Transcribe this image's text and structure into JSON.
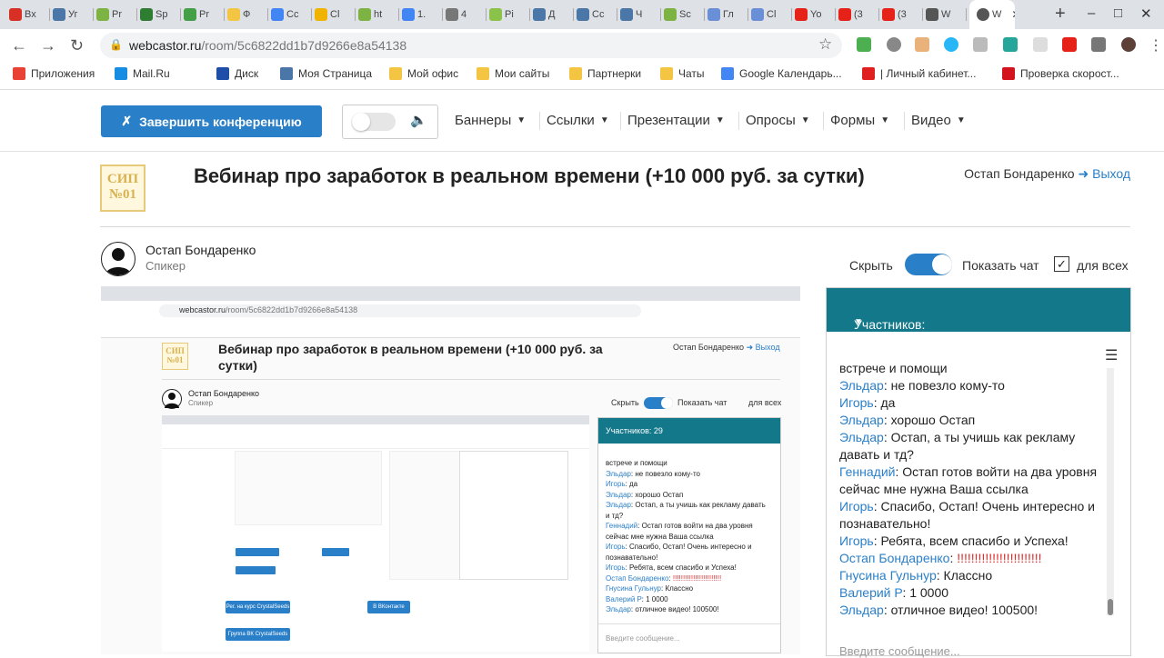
{
  "browser": {
    "tabs": [
      {
        "label": "Вх",
        "icon": "gmail-icon",
        "color": "#d93025"
      },
      {
        "label": "Уг",
        "icon": "vk-icon",
        "color": "#4a76a8"
      },
      {
        "label": "Pr",
        "icon": "jc-icon",
        "color": "#7cb342"
      },
      {
        "label": "Sp",
        "icon": "s-icon",
        "color": "#2e7d32"
      },
      {
        "label": "Pr",
        "icon": "b-icon",
        "color": "#43a047"
      },
      {
        "label": "Ф",
        "icon": "folder-icon",
        "color": "#f4c542"
      },
      {
        "label": "Сс",
        "icon": "doc-icon",
        "color": "#4285f4"
      },
      {
        "label": "Cl",
        "icon": "eye-icon",
        "color": "#f0b400"
      },
      {
        "label": "ht",
        "icon": "jc-icon",
        "color": "#7cb342"
      },
      {
        "label": "1.",
        "icon": "google-icon",
        "color": "#4285f4"
      },
      {
        "label": "4",
        "icon": "page-icon",
        "color": "#777777"
      },
      {
        "label": "Pi",
        "icon": "pb-icon",
        "color": "#8bc34a"
      },
      {
        "label": "Д",
        "icon": "chat-icon",
        "color": "#4a76a8"
      },
      {
        "label": "Сс",
        "icon": "vk-icon",
        "color": "#4a76a8"
      },
      {
        "label": "Ч",
        "icon": "vk-icon",
        "color": "#4a76a8"
      },
      {
        "label": "Sc",
        "icon": "code-icon",
        "color": "#7cb342"
      },
      {
        "label": "Гл",
        "icon": "c-icon",
        "color": "#6b8fd6"
      },
      {
        "label": "Cl",
        "icon": "c-icon",
        "color": "#6b8fd6"
      },
      {
        "label": "Yo",
        "icon": "youtube-icon",
        "color": "#e62117"
      },
      {
        "label": "(3",
        "icon": "youtube-icon",
        "color": "#e62117"
      },
      {
        "label": "(3",
        "icon": "youtube-icon",
        "color": "#e62117"
      },
      {
        "label": "W",
        "icon": "globe-icon",
        "color": "#555555"
      }
    ],
    "active_tab": {
      "label": "W",
      "icon": "globe-icon"
    },
    "url_domain": "webcastor.ru",
    "url_path": "/room/5c6822dd1b7d9266e8a54138",
    "bookmarks": [
      {
        "label": "Приложения",
        "icon": "apps-icon",
        "color": "#e94235"
      },
      {
        "label": "Mail.Ru",
        "icon": "mailru-icon",
        "color": "#168de2"
      },
      {
        "label": "Диск",
        "icon": "disk-icon",
        "color": "#1e4ea8"
      },
      {
        "label": "Моя Страница",
        "icon": "vk-icon",
        "color": "#4a76a8"
      },
      {
        "label": "Мой офис",
        "icon": "folder-icon",
        "color": "#f4c542"
      },
      {
        "label": "Мои сайты",
        "icon": "folder-icon",
        "color": "#f4c542"
      },
      {
        "label": "Партнерки",
        "icon": "folder-icon",
        "color": "#f4c542"
      },
      {
        "label": "Чаты",
        "icon": "folder-icon",
        "color": "#f4c542"
      },
      {
        "label": "Google Календарь...",
        "icon": "calendar-icon",
        "color": "#4285f4"
      },
      {
        "label": "| Личный кабинет...",
        "icon": "cabinet-icon",
        "color": "#e02020"
      },
      {
        "label": "Проверка скорост...",
        "icon": "speed-icon",
        "color": "#d4141c"
      }
    ]
  },
  "header": {
    "end_button": "Завершить конференцию",
    "menus": [
      "Баннеры",
      "Ссылки",
      "Презентации",
      "Опросы",
      "Формы",
      "Видео"
    ]
  },
  "webinar": {
    "logo_line1": "СИП",
    "logo_line2": "№01",
    "title": "Вебинар про заработок в реальном времени (+10 000 руб. за сутки)",
    "user": "Остап Бондаренко",
    "logout": "Выход",
    "speaker_name": "Остап Бондаренко",
    "speaker_role": "Спикер",
    "hide_label": "Скрыть",
    "show_chat_label": "Показать чат",
    "for_all_label": "для всех"
  },
  "chat": {
    "participants": "Участников: 29",
    "input_placeholder": "Введите сообщение...",
    "messages": [
      {
        "author": "",
        "text": "встрече и помощи"
      },
      {
        "author": "Эльдар",
        "text": "не повезло кому-то"
      },
      {
        "author": "Игорь",
        "text": "да"
      },
      {
        "author": "Эльдар",
        "text": "хорошо Остап"
      },
      {
        "author": "Эльдар",
        "text": "Остап, а ты учишь как рекламу давать и тд?"
      },
      {
        "author": "Геннадий",
        "text": "Остап готов войти на два уровня сейчас мне нужна Ваша ссылка"
      },
      {
        "author": "Игорь",
        "text": "Спасибо, Остап! Очень интересно и познавательно!"
      },
      {
        "author": "Игорь",
        "text": "Ребята, всем спасибо и Успеха!"
      },
      {
        "author": "Остап Бондаренко",
        "text": "!!!!!!!!!!!!!!!!!!!!!!!!",
        "red": true
      },
      {
        "author": "Гнусина Гульнур",
        "text": "Классно"
      },
      {
        "author": "Валерий Р",
        "text": "1 0000"
      },
      {
        "author": "Эльдар",
        "text": "отличное видео! 100500!"
      }
    ]
  },
  "shared_screen": {
    "title": "Вебинар про заработок в реальном времени (+10 000 руб. за сутки)",
    "user": "Остап Бондаренко",
    "logout": "Выход",
    "speaker_name": "Остап Бондаренко",
    "speaker_role": "Спикер",
    "participants": "Участников: 29",
    "input_placeholder": "Введите сообщение...",
    "buttons": [
      "Рег. на курс CrystalSeeds",
      "Группа ВК CrystalSeeds",
      "В ВКонтакте"
    ]
  },
  "colors": {
    "accent": "#2a7fc9",
    "chat_header": "#13788a",
    "red": "#e02a2a"
  }
}
